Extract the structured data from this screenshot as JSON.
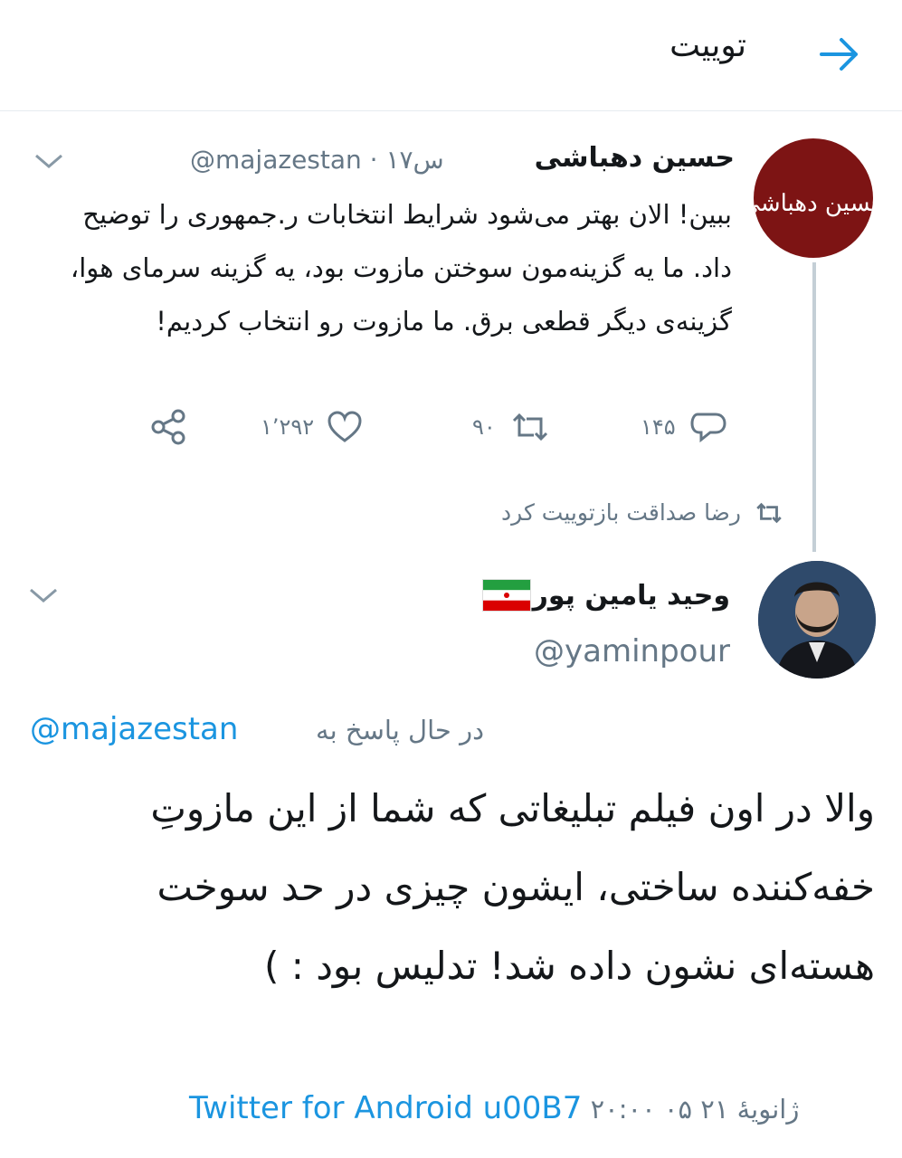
{
  "header": {
    "title": "توییت"
  },
  "tweet1": {
    "avatar_text": "حسین دهباشی",
    "name": "حسین دهباشی",
    "handle_time": "@majazestan · ۱۷س",
    "text": "ببین! الان بهتر می‌شود شرایط انتخابات ر.جمهوری را توضیح داد. ما یه گزینه‌مون سوختن مازوت بود، یه گزینه سرمای هوا، گزینه‌ی دیگر قطعی برق. ما مازوت رو انتخاب کردیم!",
    "replies": "۱۴۵",
    "retweets": "۹۰",
    "likes": "۱٬۲۹۲"
  },
  "retweet_notice": "رضا صداقت بازتوییت کرد",
  "tweet2": {
    "name": "وحید یامین پور",
    "handle": "@yaminpour",
    "replying_to_label": "در حال پاسخ به",
    "replying_to_handle": "@majazestan",
    "text": "والا در اون فیلم تبلیغاتی که شما از این مازوتِ خفه‌کننده ساختی، ایشون چیزی در حد سوخت هسته‌ای نشون داده شد! تدلیس بود : )",
    "meta_time": "۲۰:۰۰ ۰۵ ژانویهٔ ۲۱",
    "meta_app": "Twitter for Android u00B7"
  },
  "colors": {
    "accent": "#1b95e0",
    "muted": "#657786",
    "avatar1_bg": "#7d1414"
  },
  "icons": [
    "back-arrow-icon",
    "chevron-down-icon",
    "reply-icon",
    "retweet-icon",
    "like-icon",
    "share-icon",
    "iran-flag-icon"
  ]
}
